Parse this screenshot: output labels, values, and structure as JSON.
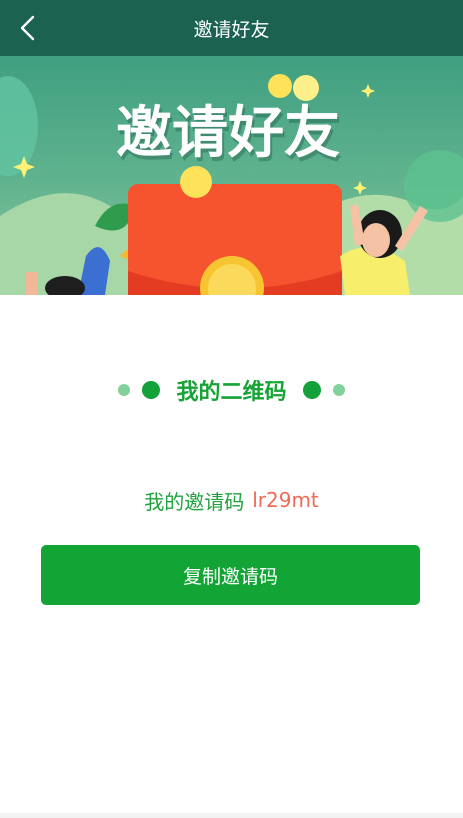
{
  "header": {
    "title": "邀请好友",
    "back_icon": "chevron-left-icon"
  },
  "banner": {
    "headline": "邀请好友",
    "coin_symbol": "¥"
  },
  "qr_section": {
    "title": "我的二维码"
  },
  "invite": {
    "label": "我的邀请码",
    "code": "lr29mt"
  },
  "copy_button": {
    "label": "复制邀请码"
  },
  "colors": {
    "header_bg": "#1b6350",
    "accent_green": "#13a436",
    "code_red": "#f06a57"
  }
}
